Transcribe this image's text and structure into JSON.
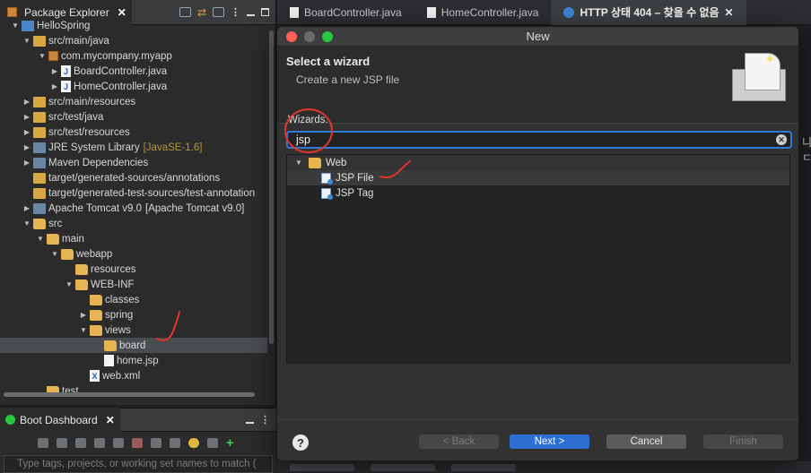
{
  "explorer": {
    "tab_label": "Package Explorer",
    "tab_close": "✕",
    "rows": [
      {
        "label": "HelloSpring",
        "icon": "project-icon",
        "tag": ""
      },
      {
        "label": "src/main/java",
        "icon": "source-folder-icon",
        "tag": ""
      },
      {
        "label": "com.mycompany.myapp",
        "icon": "package-icon",
        "tag": ""
      },
      {
        "label": "BoardController.java",
        "icon": "java-file-icon",
        "tag": ""
      },
      {
        "label": "HomeController.java",
        "icon": "java-file-icon",
        "tag": ""
      },
      {
        "label": "src/main/resources",
        "icon": "source-folder-icon",
        "tag": ""
      },
      {
        "label": "src/test/java",
        "icon": "source-folder-icon",
        "tag": ""
      },
      {
        "label": "src/test/resources",
        "icon": "source-folder-icon",
        "tag": ""
      },
      {
        "label": "JRE System Library",
        "icon": "library-icon",
        "tag": "[JavaSE-1.6]"
      },
      {
        "label": "Maven Dependencies",
        "icon": "library-icon",
        "tag": ""
      },
      {
        "label": "target/generated-sources/annotations",
        "icon": "source-folder-icon",
        "tag": ""
      },
      {
        "label": "target/generated-test-sources/test-annotation",
        "icon": "source-folder-icon",
        "tag": ""
      },
      {
        "label": "Apache Tomcat v9.0",
        "icon": "library-icon",
        "tag": "[Apache Tomcat v9.0]"
      },
      {
        "label": "src",
        "icon": "folder-icon",
        "tag": ""
      },
      {
        "label": "main",
        "icon": "folder-icon",
        "tag": ""
      },
      {
        "label": "webapp",
        "icon": "folder-icon",
        "tag": ""
      },
      {
        "label": "resources",
        "icon": "folder-icon",
        "tag": ""
      },
      {
        "label": "WEB-INF",
        "icon": "folder-icon",
        "tag": ""
      },
      {
        "label": "classes",
        "icon": "folder-icon",
        "tag": ""
      },
      {
        "label": "spring",
        "icon": "folder-icon",
        "tag": ""
      },
      {
        "label": "views",
        "icon": "folder-icon",
        "tag": ""
      },
      {
        "label": "board",
        "icon": "folder-icon",
        "tag": ""
      },
      {
        "label": "home.jsp",
        "icon": "jsp-file-icon",
        "tag": ""
      },
      {
        "label": "web.xml",
        "icon": "xml-file-icon",
        "tag": ""
      },
      {
        "label": "test",
        "icon": "folder-icon",
        "tag": ""
      }
    ]
  },
  "boot": {
    "tab_label": "Boot Dashboard",
    "tab_close": "✕",
    "filter_placeholder": "Type tags, projects, or working set names to match ("
  },
  "editor": {
    "tabs": [
      {
        "label": "BoardController.java"
      },
      {
        "label": "HomeController.java"
      },
      {
        "label": "HTTP 상태 404 – 찾을 수 없음",
        "close": "✕"
      }
    ],
    "edge_text": "니ㄷ"
  },
  "dialog": {
    "title": "New",
    "heading": "Select a wizard",
    "subheading": "Create a new JSP file",
    "wizards_label": "Wizards:",
    "search_value": "jsp",
    "tree": [
      {
        "label": "Web"
      },
      {
        "label": "JSP File"
      },
      {
        "label": "JSP Tag"
      }
    ],
    "buttons": {
      "help": "?",
      "back": "< Back",
      "next": "Next >",
      "cancel": "Cancel",
      "finish": "Finish"
    }
  },
  "colors": {
    "accent": "#2d6fd3",
    "annotation": "#e0352b",
    "selection": "#4a4d50"
  }
}
